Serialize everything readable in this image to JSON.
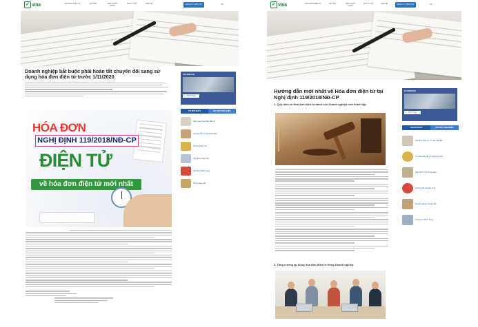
{
  "left_page": {
    "brand": "vina",
    "nav": [
      "HÓA ĐƠN ĐIỆN TỬ",
      "HỖ TRỢ",
      "HÌNH THỨC NHẬN",
      "CHỮ KÝ SỐ",
      "LIÊN HỆ"
    ],
    "cta": "ĐĂNG KÝ MIỄN PHÍ",
    "lang": "VN",
    "article_title": "Doanh nghiệp bắt buộc phải hoàn tất chuyển đổi sang sử dụng hóa đơn điện tử trước 1/11/2020",
    "promo": {
      "line1": "HÓA ĐƠN",
      "decree": "NGHỊ ĐỊNH 119/2018/NĐ-CP",
      "line2": "ĐIỆN TỬ",
      "banner": "về hóa đơn điện tử mới nhất"
    },
    "sidebar": {
      "fb_title": "FACEBOOK",
      "fb_button": "Thích Trang",
      "tabs": [
        "TIN MỚI NHẤT",
        "BÀI VIẾT XEM NHIỀU"
      ],
      "news": [
        "Cẩm nang hóa đơn điện tử",
        "Hướng dẫn sử dụng hóa đơn",
        "Tin tức thuế mới",
        "Quy định pháp luật",
        "Hỏi đáp khách hàng",
        "Thông báo mới"
      ]
    }
  },
  "right_page": {
    "brand": "vina",
    "nav": [
      "HÓA ĐƠN ĐIỆN TỬ",
      "HỖ TRỢ",
      "HÌNH THỨC NHẬN",
      "CHỮ KÝ SỐ",
      "LIÊN HỆ"
    ],
    "cta": "ĐĂNG KÝ MIỄN PHÍ",
    "lang": "VN",
    "article_title": "Hướng dẫn mới nhất về Hóa đơn điện tử tại Nghị định 119/2018/NĐ-CP",
    "subhead1": "1. Quy định về Hóa đơn điện tử dành cho Doanh nghiệp mới thành lập",
    "subhead2": "2. Tăng cường áp dụng hóa đơn điện tử trong Doanh nghiệp",
    "sidebar": {
      "fb_title": "FACEBOOK",
      "fb_button": "Thích Trang",
      "tabs": [
        "TIN MỚI NHẤT",
        "BÀI VIẾT XEM NHIỀU"
      ],
      "news": [
        "Hóa đơn điện tử - Từ lâu bắt đầu",
        "Có cách nào để sử dụng hóa đơn",
        "Nghị định 119 về hóa đơn",
        "Hướng dẫn kê khai thuế",
        "Doanh nghiệp chuyển đổi",
        "Thông tin khách hàng"
      ]
    }
  },
  "colors": {
    "brand_green": "#1b8a3a",
    "cta_blue": "#2b73c2",
    "facebook_blue": "#3b5998",
    "decree_pink": "#d83c88",
    "promo_red": "#e53a2f",
    "promo_green": "#2a8c33"
  }
}
